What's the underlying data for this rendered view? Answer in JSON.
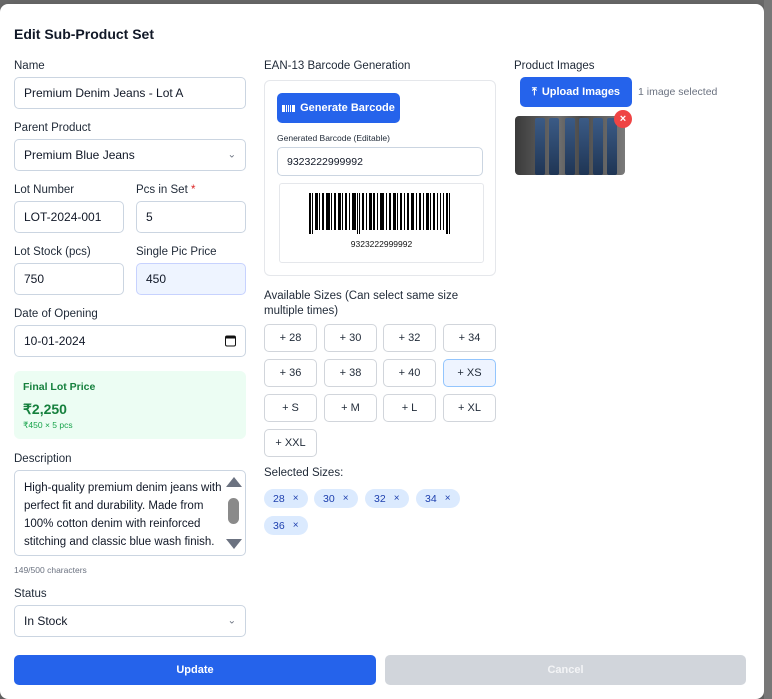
{
  "modal": {
    "title": "Edit Sub-Product Set"
  },
  "form": {
    "name": {
      "label": "Name",
      "value": "Premium Denim Jeans - Lot A"
    },
    "parent_product": {
      "label": "Parent Product",
      "value": "Premium Blue Jeans"
    },
    "lot_number": {
      "label": "Lot Number",
      "value": "LOT-2024-001"
    },
    "pcs_in_set": {
      "label": "Pcs in Set",
      "required_mark": "*",
      "value": "5"
    },
    "lot_stock": {
      "label": "Lot Stock (pcs)",
      "value": "750"
    },
    "single_pic_price": {
      "label": "Single Pic Price",
      "value": "450"
    },
    "date_of_opening": {
      "label": "Date of Opening",
      "value": "10-01-2024"
    },
    "final_lot_price": {
      "label": "Final Lot Price",
      "value": "₹2,250",
      "formula": "₹450 × 5 pcs"
    },
    "description": {
      "label": "Description",
      "value": "High-quality premium denim jeans with perfect fit and durability. Made from 100% cotton denim with reinforced stitching and classic blue wash finish.",
      "char_count": "149/500 characters"
    },
    "status": {
      "label": "Status",
      "value": "In Stock"
    }
  },
  "barcode": {
    "section_label": "EAN-13 Barcode Generation",
    "generate_button": "Generate Barcode",
    "field_label": "Generated Barcode (Editable)",
    "value": "9323222999992",
    "image_number": "9323222999992"
  },
  "sizes": {
    "label": "Available Sizes (Can select same size multiple times)",
    "buttons": [
      "+ 28",
      "+ 30",
      "+ 32",
      "+ 34",
      "+ 36",
      "+ 38",
      "+ 40",
      "+ XS",
      "+ S",
      "+ M",
      "+ L",
      "+ XL",
      "+ XXL"
    ],
    "selected_label": "Selected Sizes:",
    "selected": [
      "28",
      "30",
      "32",
      "34",
      "36"
    ],
    "remove_glyph": "×"
  },
  "images": {
    "label": "Product Images",
    "upload_button": "Upload Images",
    "note": "1 image selected",
    "remove_glyph": "×"
  },
  "actions": {
    "update": "Update",
    "cancel": "Cancel"
  },
  "colors": {
    "primary": "#2563eb",
    "success": "#15803d",
    "danger": "#ef4444",
    "chip_bg": "#dbeafe"
  },
  "icons": {
    "generate": "barcode-icon",
    "upload": "upload-icon",
    "select": "chevron-down-icon",
    "date": "calendar-icon"
  }
}
